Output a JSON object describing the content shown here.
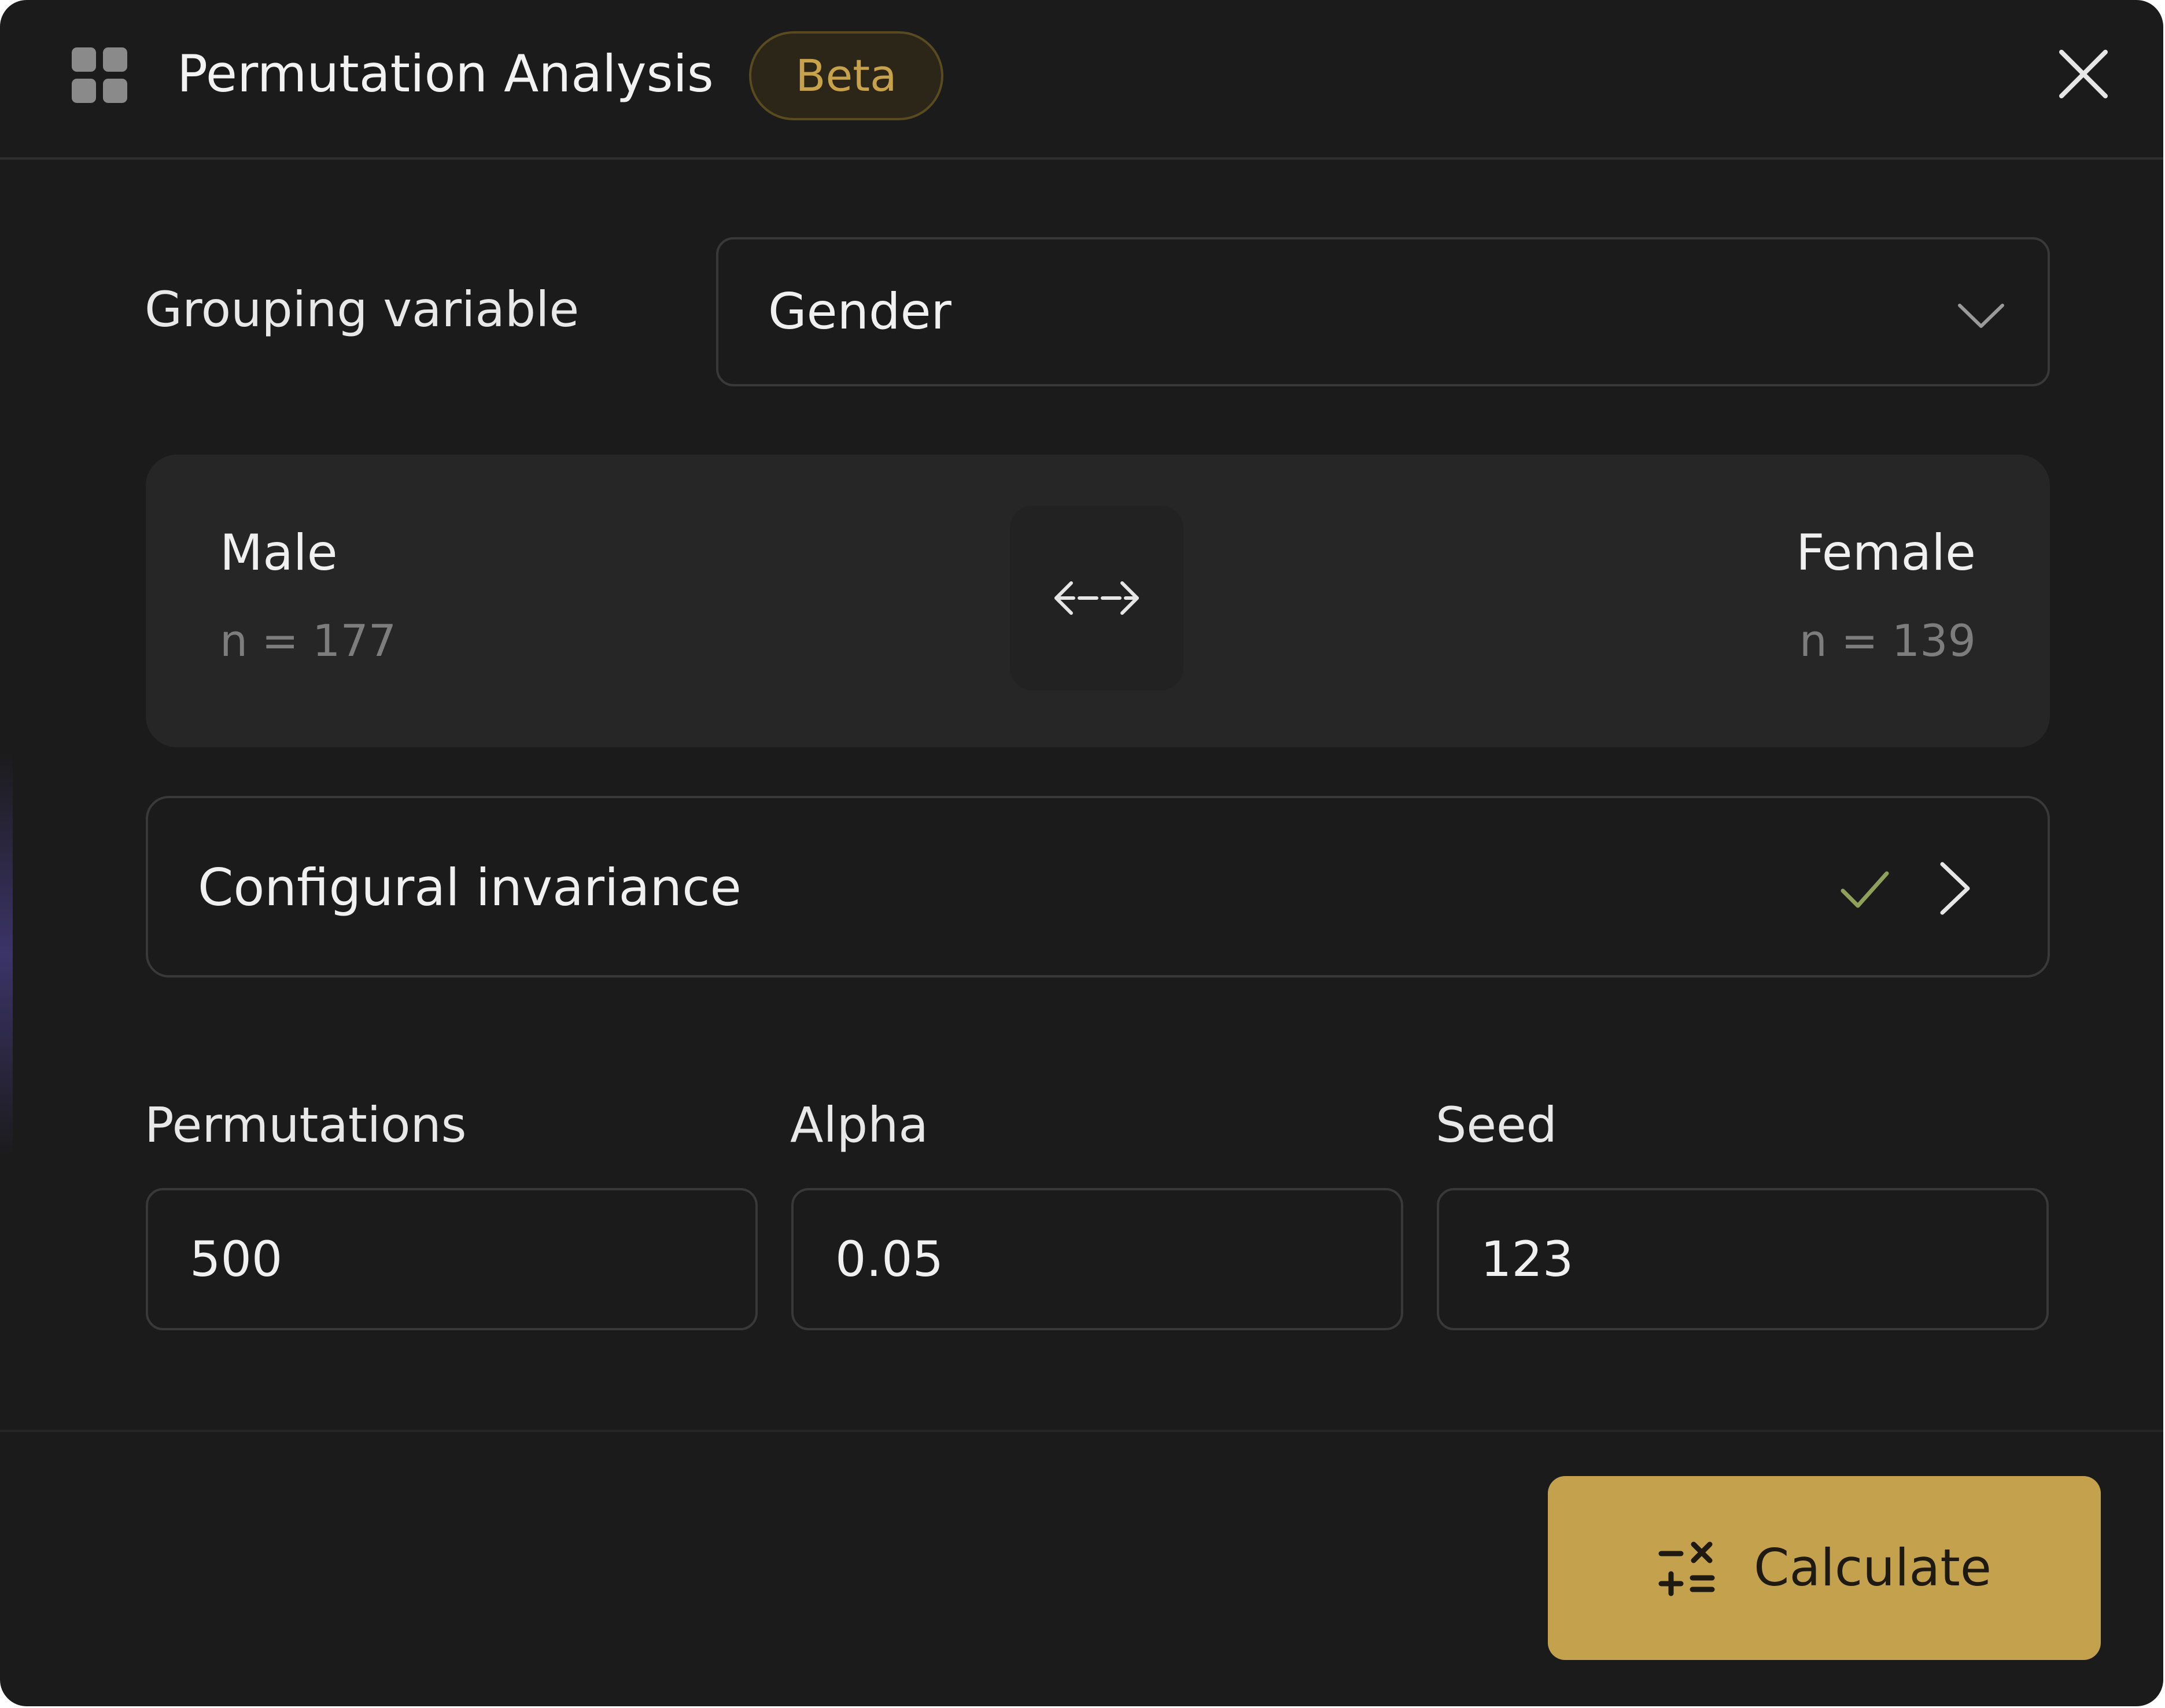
{
  "header": {
    "title": "Permutation Analysis",
    "badge": "Beta",
    "icons": {
      "app": "grid-icon",
      "close": "close-icon"
    }
  },
  "grouping": {
    "label": "Grouping variable",
    "selected": "Gender",
    "icon": "chevron-down-icon"
  },
  "groups": {
    "left": {
      "name": "Male",
      "n": "n = 177"
    },
    "right": {
      "name": "Female",
      "n": "n = 139"
    },
    "swap_icon": "swap-arrows-icon"
  },
  "invariance": {
    "label": "Configural invariance",
    "status_icon": "check-icon",
    "nav_icon": "chevron-right-icon"
  },
  "params": {
    "permutations": {
      "label": "Permutations",
      "value": "500"
    },
    "alpha": {
      "label": "Alpha",
      "value": "0.05"
    },
    "seed": {
      "label": "Seed",
      "value": "123"
    }
  },
  "footer": {
    "calculate_label": "Calculate",
    "calculate_icon": "calculator-icon"
  },
  "colors": {
    "background": "#1b1b1b",
    "accent": "#c4a14d",
    "badge_text": "#c8a24a",
    "check": "#8fa05a",
    "muted_text": "#7d7d7d"
  }
}
